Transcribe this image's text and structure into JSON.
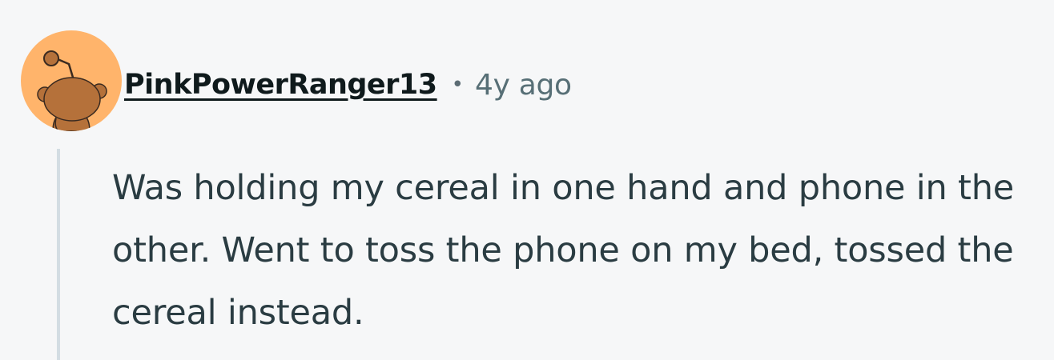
{
  "comment": {
    "author": "PinkPowerRanger13",
    "separator": "•",
    "age": "4y ago",
    "body": "Was holding my cereal in one hand and phone in the other. Went to toss the phone on my bed, tossed the cereal instead."
  },
  "avatar": {
    "icon": "snoo-avatar-icon",
    "background_color": "#ffb46b",
    "figure_color": "#b5713a"
  },
  "colors": {
    "page_background": "#f6f7f8",
    "username": "#0f1a1c",
    "meta": "#576f76",
    "body_text": "#2a3c42",
    "thread_line": "#d3dde3"
  }
}
